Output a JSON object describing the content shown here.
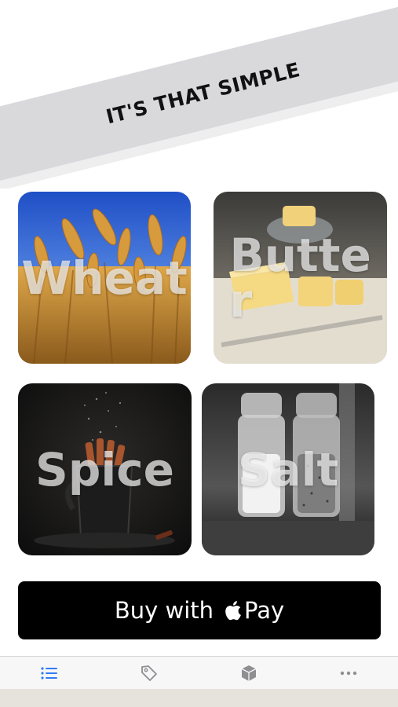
{
  "banner": {
    "text": "IT'S THAT SIMPLE"
  },
  "tiles": [
    {
      "label": "Wheat"
    },
    {
      "label": "Butter"
    },
    {
      "label": "Spice"
    },
    {
      "label": "Salt"
    }
  ],
  "pay_button": {
    "prefix": "Buy with",
    "suffix": "Pay"
  },
  "tabbar": {
    "tabs": [
      {
        "icon": "list-icon",
        "active": true
      },
      {
        "icon": "tag-icon",
        "active": false
      },
      {
        "icon": "box-icon",
        "active": false
      },
      {
        "icon": "more-icon",
        "active": false
      }
    ]
  },
  "colors": {
    "accent": "#2f7cf6",
    "inactive": "#8e8e93",
    "banner": "#d9d9db"
  }
}
